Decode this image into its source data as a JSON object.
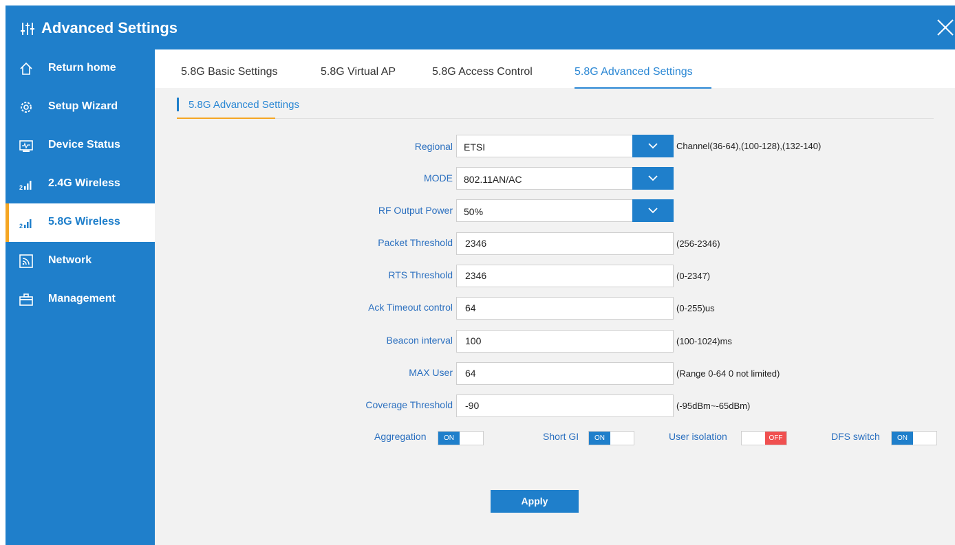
{
  "window": {
    "title": "Advanced Settings",
    "title_icon": "sliders-icon",
    "close_icon": "close-icon"
  },
  "sidebar": {
    "items": [
      {
        "label": "Return home",
        "icon": "home-icon",
        "active": false
      },
      {
        "label": "Setup Wizard",
        "icon": "gear-icon",
        "active": false
      },
      {
        "label": "Device Status",
        "icon": "monitor-icon",
        "active": false
      },
      {
        "label": "2.4G Wireless",
        "icon": "signal-2g-icon",
        "active": false
      },
      {
        "label": "5.8G Wireless",
        "icon": "signal-5g-icon",
        "active": true
      },
      {
        "label": "Network",
        "icon": "network-icon",
        "active": false
      },
      {
        "label": "Management",
        "icon": "toolbox-icon",
        "active": false
      }
    ]
  },
  "tabs": [
    {
      "label": "5.8G Basic Settings",
      "active": false
    },
    {
      "label": "5.8G Virtual AP",
      "active": false
    },
    {
      "label": "5.8G Access Control",
      "active": false
    },
    {
      "label": "5.8G Advanced Settings",
      "active": true
    }
  ],
  "section": {
    "title": "5.8G Advanced Settings"
  },
  "form": {
    "regional": {
      "label": "Regional",
      "value": "ETSI",
      "hint": "Channel(36-64),(100-128),(132-140)"
    },
    "mode": {
      "label": "MODE",
      "value": "802.11AN/AC"
    },
    "rf_power": {
      "label": "RF Output Power",
      "value": "50%"
    },
    "packet_threshold": {
      "label": "Packet Threshold",
      "value": "2346",
      "hint": "(256-2346)"
    },
    "rts_threshold": {
      "label": "RTS Threshold",
      "value": "2346",
      "hint": "(0-2347)"
    },
    "ack_timeout": {
      "label": "Ack Timeout control",
      "value": "64",
      "hint": "(0-255)us"
    },
    "beacon_interval": {
      "label": "Beacon interval",
      "value": "100",
      "hint": "(100-1024)ms"
    },
    "max_user": {
      "label": "MAX User",
      "value": "64",
      "hint": "(Range 0-64 0 not limited)"
    },
    "coverage_threshold": {
      "label": "Coverage Threshold",
      "value": "-90",
      "hint": "(-95dBm~-65dBm)"
    }
  },
  "toggles": {
    "aggregation": {
      "label": "Aggregation",
      "state": "ON"
    },
    "short_gi": {
      "label": "Short GI",
      "state": "ON"
    },
    "user_isolation": {
      "label": "User isolation",
      "state": "OFF"
    },
    "dfs_switch": {
      "label": "DFS switch",
      "state": "ON"
    }
  },
  "actions": {
    "apply": "Apply"
  },
  "colors": {
    "primary": "#1f7fcb",
    "accent": "#f5a623",
    "off": "#f05050",
    "link": "#2a87d4"
  }
}
